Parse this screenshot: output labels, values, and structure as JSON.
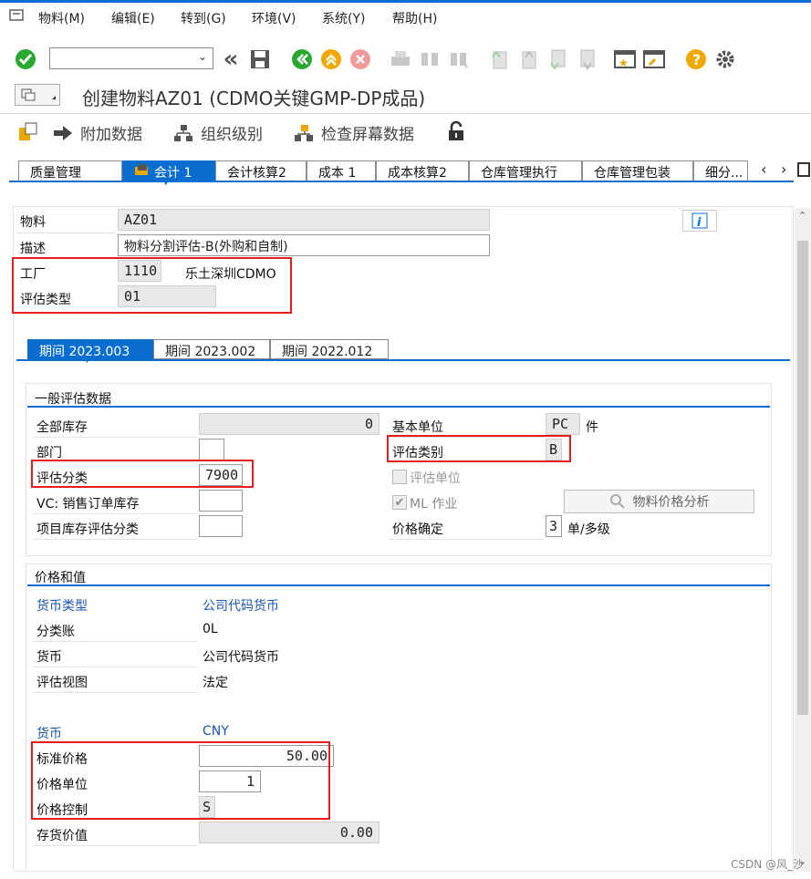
{
  "menu": [
    "物料(M)",
    "编辑(E)",
    "转到(G)",
    "环境(V)",
    "系统(Y)",
    "帮助(H)"
  ],
  "title": "创建物料AZ01 (CDMO关键GMP-DP成品)",
  "appbar": {
    "additional": "附加数据",
    "org": "组织级别",
    "check": "检查屏幕数据"
  },
  "tabs": [
    "质量管理",
    "会计 1",
    "会计核算2",
    "成本 1",
    "成本核算2",
    "仓库管理执行",
    "仓库管理包装",
    "细分..."
  ],
  "header": {
    "material_label": "物料",
    "material_value": "AZ01",
    "desc_label": "描述",
    "desc_value": "物料分割评估-B(外购和自制)",
    "plant_label": "工厂",
    "plant_value": "1110",
    "plant_name": "乐土深圳CDMO",
    "valtype_label": "评估类型",
    "valtype_value": "01"
  },
  "periods": [
    "期间 2023.003",
    "期间 2023.002",
    "期间 2022.012"
  ],
  "general": {
    "title": "一般评估数据",
    "total_stock_label": "全部库存",
    "total_stock_value": "0",
    "division_label": "部门",
    "division_value": "",
    "val_class_label": "评估分类",
    "val_class_value": "7900",
    "vc_label": "VC: 销售订单库存",
    "vc_value": "",
    "proj_label": "项目库存评估分类",
    "proj_value": "",
    "base_unit_label": "基本单位",
    "base_unit_value": "PC",
    "base_unit_text": "件",
    "val_cat_label": "评估类别",
    "val_cat_value": "B",
    "val_unit_label": "评估单位",
    "ml_label": "ML 作业",
    "price_analysis": "物料价格分析",
    "price_det_label": "价格确定",
    "price_det_value": "3",
    "price_det_text": "单/多级"
  },
  "prices": {
    "title": "价格和值",
    "currency_type_label": "货币类型",
    "currency_type_value": "公司代码货币",
    "ledger_label": "分类账",
    "ledger_value": "0L",
    "currency_label": "货币",
    "currency_value": "公司代码货币",
    "view_label": "评估视图",
    "view_value": "法定",
    "cur2_label": "货币",
    "cur2_value": "CNY",
    "std_price_label": "标准价格",
    "std_price_value": "50.00",
    "price_unit_label": "价格单位",
    "price_unit_value": "1",
    "price_ctrl_label": "价格控制",
    "price_ctrl_value": "S",
    "stock_value_label": "存货价值",
    "stock_value_value": "0.00"
  },
  "watermark": "CSDN @风_沙"
}
